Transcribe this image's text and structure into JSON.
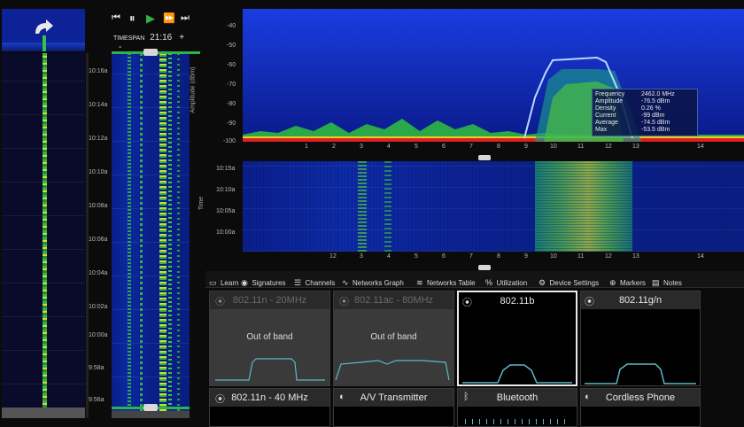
{
  "player": {
    "timespan_label": "TIMESPAN",
    "timespan_value": "21:16",
    "plus": "+",
    "minus": "-",
    "times": [
      "10:16a",
      "10:14a",
      "10:12a",
      "10:10a",
      "10:08a",
      "10:06a",
      "10:04a",
      "10:02a",
      "10:00a",
      "9:58a",
      "9:56a"
    ]
  },
  "spectrum": {
    "ylabel": "Amplitude (dBm)",
    "yticks": [
      "-40",
      "-50",
      "-60",
      "-70",
      "-80",
      "-90",
      "-100"
    ],
    "xticks": [
      "1",
      "2",
      "3",
      "4",
      "5",
      "6",
      "7",
      "8",
      "9",
      "10",
      "11",
      "12",
      "13",
      "14"
    ],
    "tooltip": {
      "rows": [
        {
          "k": "Frequency",
          "v": "2462.0 MHz"
        },
        {
          "k": "Amplitude",
          "v": "-76.5 dBm"
        },
        {
          "k": "Density",
          "v": "0.26 %"
        },
        {
          "k": "Current",
          "v": "-99 dBm"
        },
        {
          "k": "Average",
          "v": "-74.5 dBm"
        },
        {
          "k": "Max",
          "v": "-53.5 dBm"
        }
      ]
    }
  },
  "waterfall": {
    "ylabel": "Time",
    "yticks": [
      "10:15a",
      "10:10a",
      "10:05a",
      "10:00a"
    ],
    "xticks": [
      "1",
      "2",
      "3",
      "4",
      "5",
      "6",
      "7",
      "8",
      "9",
      "10",
      "11",
      "12",
      "13",
      "14"
    ]
  },
  "tabs": [
    {
      "label": "Learn",
      "icon": "book-icon"
    },
    {
      "label": "Signatures",
      "icon": "wifi-signal-icon",
      "active": true
    },
    {
      "label": "Channels",
      "icon": "channels-icon"
    },
    {
      "label": "Networks Graph",
      "icon": "graph-icon"
    },
    {
      "label": "Networks Table",
      "icon": "wifi-icon"
    },
    {
      "label": "Utilization",
      "icon": "percent-icon"
    },
    {
      "label": "Device Settings",
      "icon": "gear-icon"
    },
    {
      "label": "Markers",
      "icon": "target-icon"
    },
    {
      "label": "Notes",
      "icon": "notes-icon"
    }
  ],
  "signatures": [
    {
      "title": "802.11n - 20MHz",
      "status": "Out of band",
      "dim": true
    },
    {
      "title": "802.11ac - 80MHz",
      "status": "Out of band",
      "dim": true
    },
    {
      "title": "802.11b",
      "status": "",
      "selected": true
    },
    {
      "title": "802.11g/n",
      "status": ""
    },
    {
      "title": "802.11n - 40 MHz",
      "status": ""
    },
    {
      "title": "A/V Transmitter",
      "status": ""
    },
    {
      "title": "Bluetooth",
      "status": ""
    },
    {
      "title": "Cordless Phone",
      "status": ""
    }
  ],
  "colors": {
    "accent": "#2fb24a",
    "trace": "#b8d8ff",
    "sig": "#5fb8c8"
  }
}
